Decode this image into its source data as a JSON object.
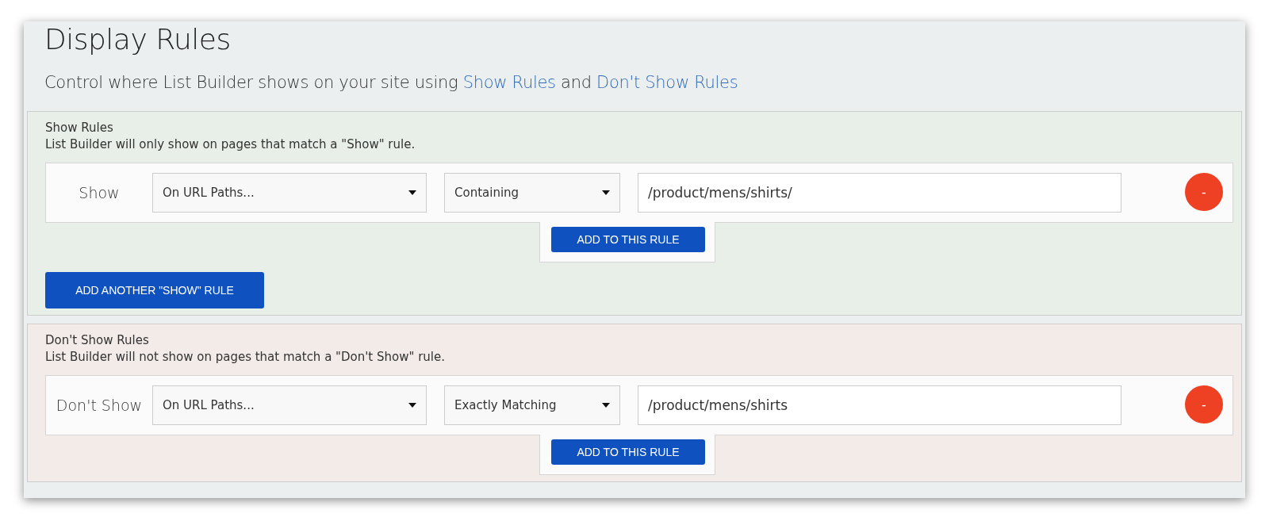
{
  "title": "Display Rules",
  "intro": {
    "text": "Control where List Builder shows on your site using",
    "link_1": "Show Rules",
    "joiner": "and",
    "link_2": "Don't Show Rules"
  },
  "sections": [
    {
      "kind": "show",
      "heading": "Show Rules",
      "description": "List Builder will only show on pages that match a \"Show\" rule.",
      "rule": {
        "label": "Show",
        "target": "On URL Paths...",
        "match": "Containing",
        "value": "/product/mens/shirts/",
        "remove": "-",
        "add_button": "ADD TO THIS RULE"
      },
      "add_another": "ADD ANOTHER \"SHOW\" RULE"
    },
    {
      "kind": "dont_show",
      "heading": "Don't Show Rules",
      "description": "List Builder will not show on pages that match a \"Don't Show\" rule.",
      "rule": {
        "label": "Don't Show",
        "target": "On URL Paths...",
        "match": "Exactly Matching",
        "value": "/product/mens/shirts",
        "remove": "-",
        "add_button": "ADD TO THIS RULE"
      }
    }
  ]
}
